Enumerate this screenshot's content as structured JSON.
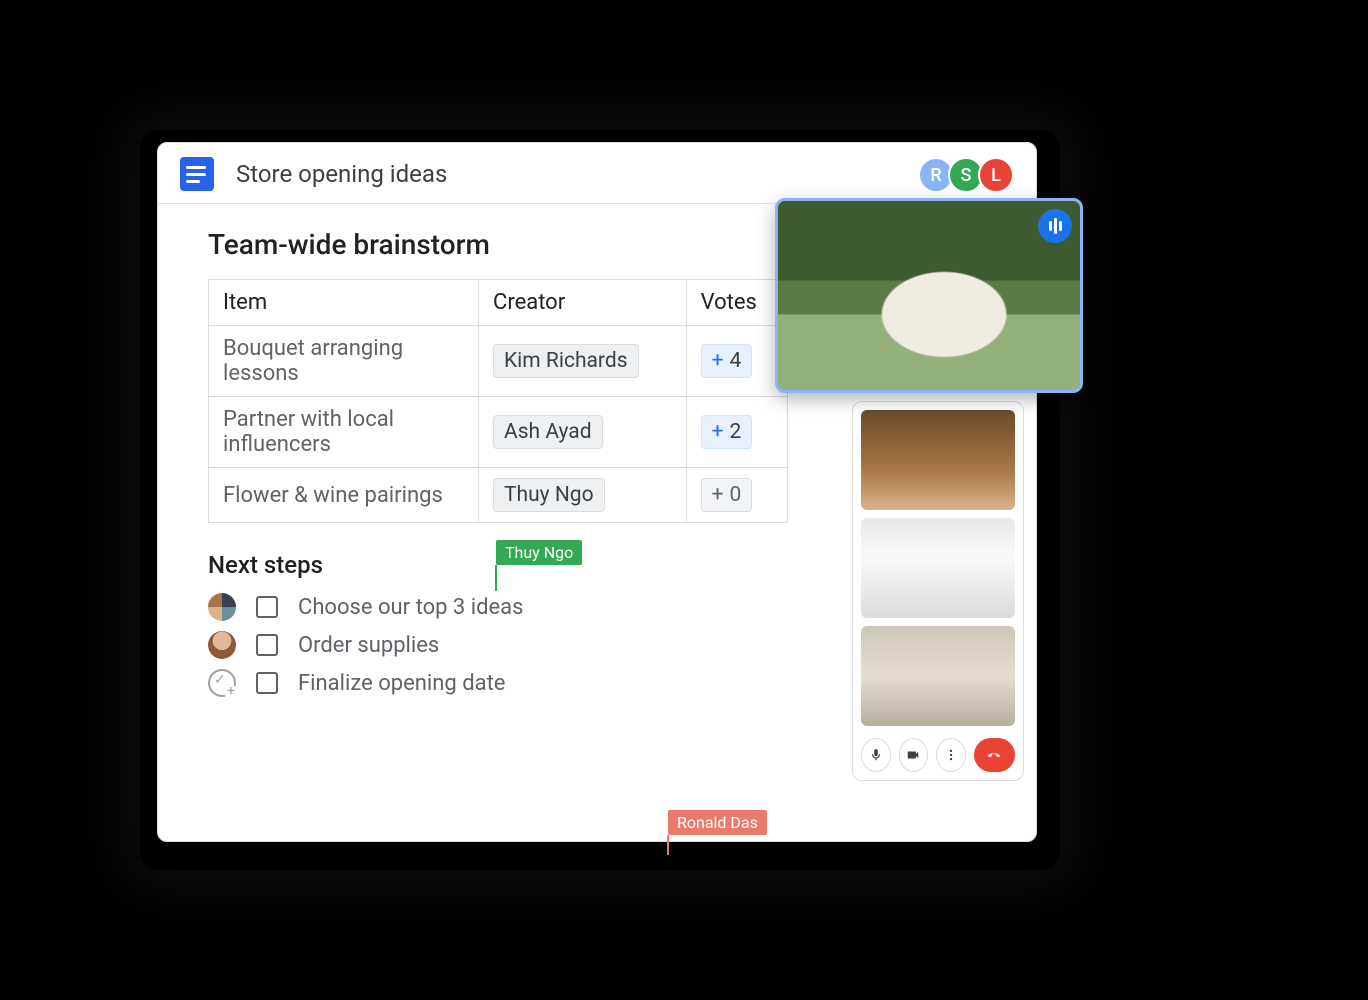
{
  "doc": {
    "title": "Store opening ideas"
  },
  "presence": [
    {
      "initial": "R",
      "name": "Ronald",
      "color": "#8ab4f8"
    },
    {
      "initial": "S",
      "name": "S",
      "color": "#34a853"
    },
    {
      "initial": "L",
      "name": "L",
      "color": "#ea4335"
    }
  ],
  "section_title": "Team-wide brainstorm",
  "table": {
    "headers": {
      "item": "Item",
      "creator": "Creator",
      "votes": "Votes"
    },
    "rows": [
      {
        "item": "Bouquet arranging lessons",
        "creator": "Kim Richards",
        "votes": 4,
        "vote_style": "blue"
      },
      {
        "item": "Partner with local influencers",
        "creator": "Ash Ayad",
        "votes": 2,
        "vote_style": "blue"
      },
      {
        "item": "Flower & wine pairings",
        "creator": "Thuy Ngo",
        "votes": 0,
        "vote_style": "zero"
      }
    ]
  },
  "live_cursors": {
    "green": "Thuy Ngo",
    "red": "Ronald Das"
  },
  "next_steps": {
    "title": "Next steps",
    "items": [
      {
        "text": "Choose our top 3 ideas",
        "assignee": "multi"
      },
      {
        "text": "Order supplies",
        "assignee": "single"
      },
      {
        "text": "Finalize opening date",
        "assignee": "add"
      }
    ]
  },
  "meet": {
    "controls": {
      "mic": "mic",
      "camera": "camera",
      "more": "more",
      "hangup": "hangup"
    }
  },
  "plus_sign": "+"
}
